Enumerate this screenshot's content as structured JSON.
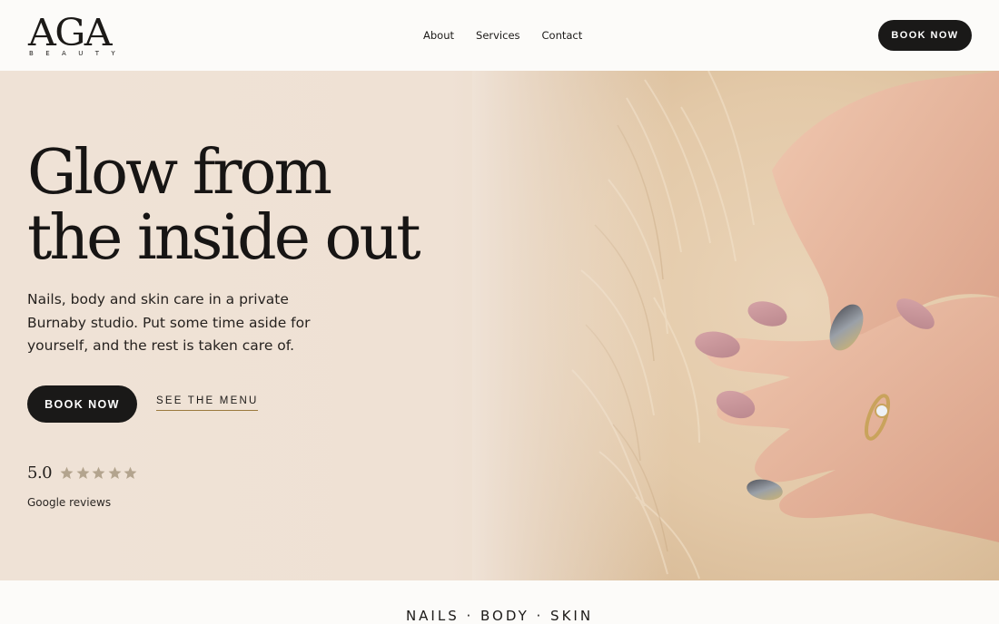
{
  "brand": {
    "name": "AGA",
    "tagline": "BEAUTY"
  },
  "nav": {
    "items": [
      "About",
      "Services",
      "Contact"
    ]
  },
  "header": {
    "cta_label": "BOOK NOW"
  },
  "hero": {
    "title_line1": "Glow from",
    "title_line2": "the inside out",
    "description": "Nails, body and skin care in a private Burnaby studio. Put some time aside for yourself, and the rest is taken care of.",
    "primary_cta": "BOOK NOW",
    "secondary_cta": "SEE THE MENU",
    "rating": {
      "score": "5.0",
      "stars": 5,
      "label": "Google reviews"
    }
  },
  "strip": {
    "text": "NAILS · BODY · SKIN"
  },
  "colors": {
    "accent_dark": "#1a1918",
    "underline_gold": "#9b7a3d",
    "star": "#b3a48e",
    "background": "#fbf9f7",
    "hero_bg": "#efe2d6"
  }
}
